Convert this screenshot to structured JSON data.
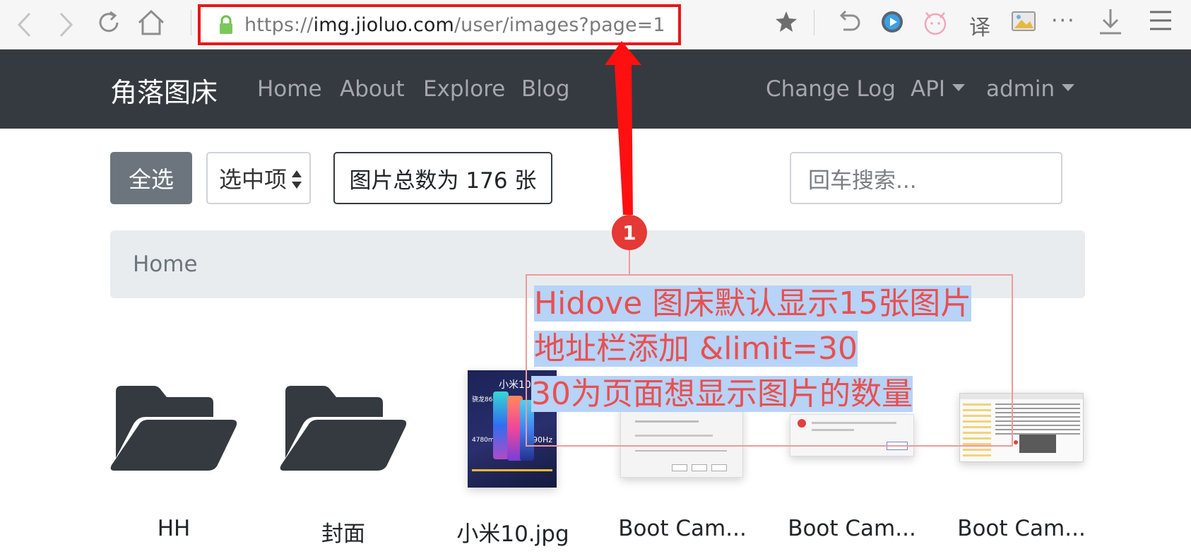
{
  "browser": {
    "url_scheme": "https://",
    "url_host": "img.jioluo.com",
    "url_path": "/user/images?page=1",
    "translate_label": "译",
    "more_label": "···"
  },
  "navbar": {
    "brand": "角落图床",
    "links": [
      "Home",
      "About",
      "Explore",
      "Blog"
    ],
    "right_links": [
      "Change Log",
      "API",
      "admin"
    ]
  },
  "controls": {
    "select_all": "全选",
    "selected_items": "选中项",
    "total_count": "图片总数为 176 张",
    "search_placeholder": "回车搜索..."
  },
  "breadcrumb": {
    "home": "Home"
  },
  "grid": {
    "items": [
      {
        "type": "folder",
        "label": "HH"
      },
      {
        "type": "folder",
        "label": "封面"
      },
      {
        "type": "image",
        "label": "小米10.jpg"
      },
      {
        "type": "image",
        "label": "Boot Cam..."
      },
      {
        "type": "image",
        "label": "Boot Cam..."
      },
      {
        "type": "image",
        "label": "Boot Cam..."
      }
    ]
  },
  "annotation": {
    "marker": "1",
    "lines": [
      "Hidove 图床默认显示15张图片",
      "地址栏添加 &limit=30",
      "30为页面想显示图片的数量"
    ],
    "color": "#e53935"
  },
  "thumb_texts": {
    "mi_title": "小米10",
    "mi_chip": "骁龙865",
    "mi_hz": "90Hz",
    "mi_battery": "4780mAh"
  },
  "colors": {
    "navbar": "#343a40",
    "secondary": "#6c757d",
    "breadcrumb_bg": "#e9ecef",
    "highlight": "#b7d3f7"
  }
}
